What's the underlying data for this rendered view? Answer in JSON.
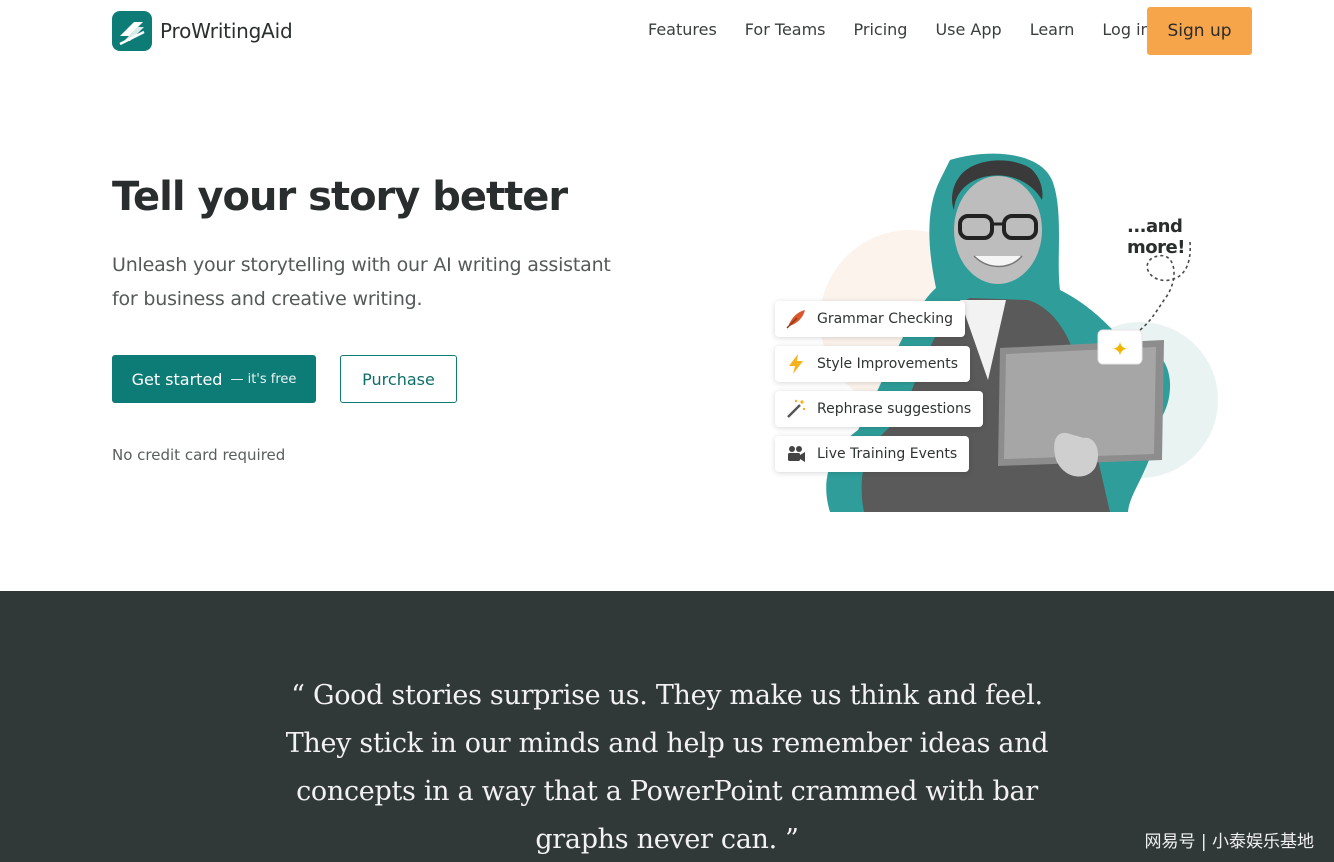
{
  "brand": {
    "name": "ProWritingAid",
    "accent": "#0e7c76",
    "cta_color": "#f7a54a",
    "dark_band": "#313838"
  },
  "nav": {
    "links": [
      "Features",
      "For Teams",
      "Pricing",
      "Use App",
      "Learn"
    ],
    "login": "Log in",
    "signup": "Sign up"
  },
  "hero": {
    "title": "Tell your story better",
    "subtitle": "Unleash your storytelling with our AI writing assistant for business and creative writing.",
    "cta_primary": "Get started",
    "cta_primary_note": "— it's free",
    "cta_secondary": "Purchase",
    "note": "No credit card required"
  },
  "features": {
    "chips": [
      {
        "label": "Grammar Checking",
        "icon": "feather-icon"
      },
      {
        "label": "Style Improvements",
        "icon": "lightning-icon"
      },
      {
        "label": "Rephrase suggestions",
        "icon": "magic-wand-icon"
      },
      {
        "label": "Live Training Events",
        "icon": "video-camera-icon"
      }
    ],
    "more": "...and more!"
  },
  "quote": {
    "text": "“ Good stories surprise us. They make us think and feel. They stick in our minds and help us remember ideas and concepts in a way that a PowerPoint crammed with bar graphs never can. ”"
  },
  "watermark": "网易号 | 小泰娱乐基地"
}
